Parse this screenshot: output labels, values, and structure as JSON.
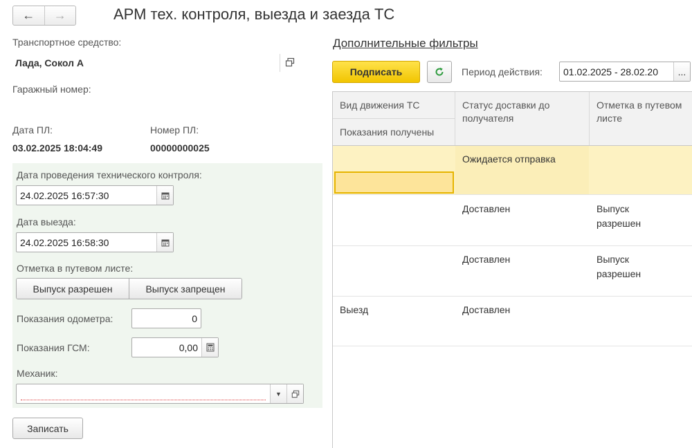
{
  "nav": {
    "back_icon": "arrow-left-icon",
    "forward_icon": "arrow-right-icon"
  },
  "window": {
    "title": "АРМ тех. контроля, выезда и заезда ТС"
  },
  "left": {
    "vehicle_label": "Транспортное средство:",
    "vehicle_value": "Лада, Сокол А",
    "garage_label": "Гаражный номер:",
    "pl_date_label": "Дата ПЛ:",
    "pl_date_value": "03.02.2025 18:04:49",
    "pl_number_label": "Номер ПЛ:",
    "pl_number_value": "00000000025",
    "tech_date_label": "Дата проведения технического контроля:",
    "tech_date_value": "24.02.2025 16:57:30",
    "departure_label": "Дата выезда:",
    "departure_value": "24.02.2025 16:58:30",
    "waybill_mark_label": "Отметка в путевом листе:",
    "release_allowed": "Выпуск разрешен",
    "release_denied": "Выпуск запрещен",
    "odometer_label": "Показания одометра:",
    "odometer_value": "0",
    "fuel_label": "Показания ГСМ:",
    "fuel_value": "0,00",
    "mechanic_label": "Механик:",
    "mechanic_value": "",
    "save_button": "Записать"
  },
  "right": {
    "filters_link": "Дополнительные фильтры",
    "sign_button": "Подписать",
    "period_label": "Период действия:",
    "period_value": "01.02.2025 - 28.02.20",
    "more_button": "..."
  },
  "table": {
    "headers": {
      "movement": "Вид движения ТС",
      "readings": "Показания получены",
      "status": "Статус доставки до получателя",
      "mark": "Отметка в путевом листе"
    },
    "rows": [
      {
        "movement": "",
        "status": "Ожидается отправка",
        "mark": ""
      },
      {
        "movement": "",
        "status": "Доставлен",
        "mark": "Выпуск разрешен"
      },
      {
        "movement": "",
        "status": "Доставлен",
        "mark": "Выпуск разрешен"
      },
      {
        "movement": "Выезд",
        "status": "Доставлен",
        "mark": ""
      }
    ]
  },
  "colors": {
    "accent_yellow": "#f5d000",
    "selected_row": "#fdf2c2",
    "panel_green": "#f0f6ef",
    "refresh_green": "#2e9b3e"
  }
}
